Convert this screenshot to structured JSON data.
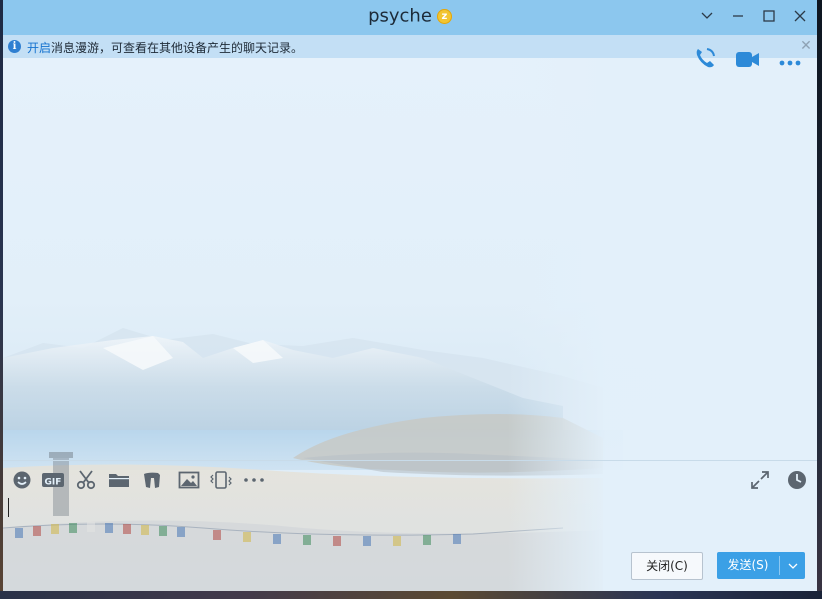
{
  "window": {
    "title": "psyche",
    "vip_badge": "z"
  },
  "infobar": {
    "link": "开启",
    "message": "消息漫游，可查看在其他设备产生的聊天记录。"
  },
  "header_actions": {
    "icons": [
      "phone-call-icon",
      "video-call-icon",
      "more-icon"
    ]
  },
  "toolbar": {
    "icons": [
      "emoji-icon",
      "gif-icon",
      "scissors-icon",
      "folder-icon",
      "sticker-icon",
      "image-icon",
      "shake-icon",
      "more-icon",
      "expand-icon",
      "history-clock-icon"
    ]
  },
  "input": {
    "value": ""
  },
  "buttons": {
    "close_label": "关闭(C)",
    "send_label": "发送(S)"
  },
  "colors": {
    "titlebar": "#8cc7ee",
    "infobar": "#c3dff5",
    "accent": "#3ba0e6",
    "link": "#1673cf"
  }
}
